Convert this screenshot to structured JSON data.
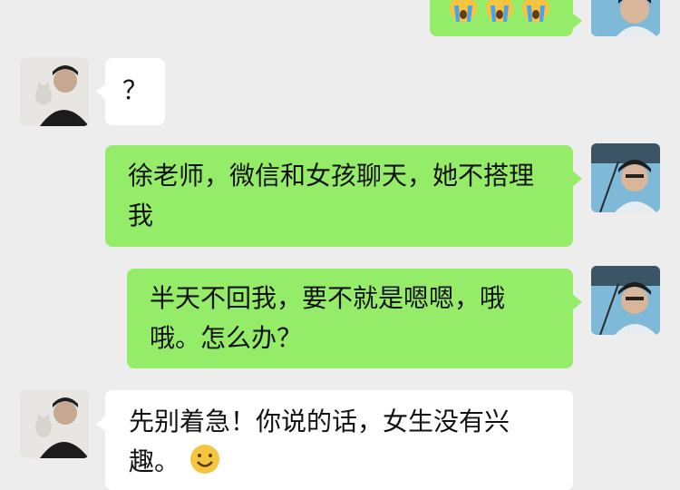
{
  "chat": {
    "messages": [
      {
        "sender": "me",
        "kind": "emoji",
        "emojis": [
          "crying-face-icon",
          "crying-face-icon",
          "crying-face-icon"
        ]
      },
      {
        "sender": "them",
        "text": "？"
      },
      {
        "sender": "me",
        "text": "徐老师，微信和女孩聊天，她不搭理我"
      },
      {
        "sender": "me",
        "text": "半天不回我，要不就是嗯嗯，哦哦。怎么办？"
      },
      {
        "sender": "them",
        "text": "先别着急！你说的话，女生没有兴趣。",
        "trailing_emoji": "smile-face-icon"
      }
    ]
  },
  "colors": {
    "background": "#ededed",
    "my_bubble": "#95ec69",
    "their_bubble": "#ffffff"
  }
}
